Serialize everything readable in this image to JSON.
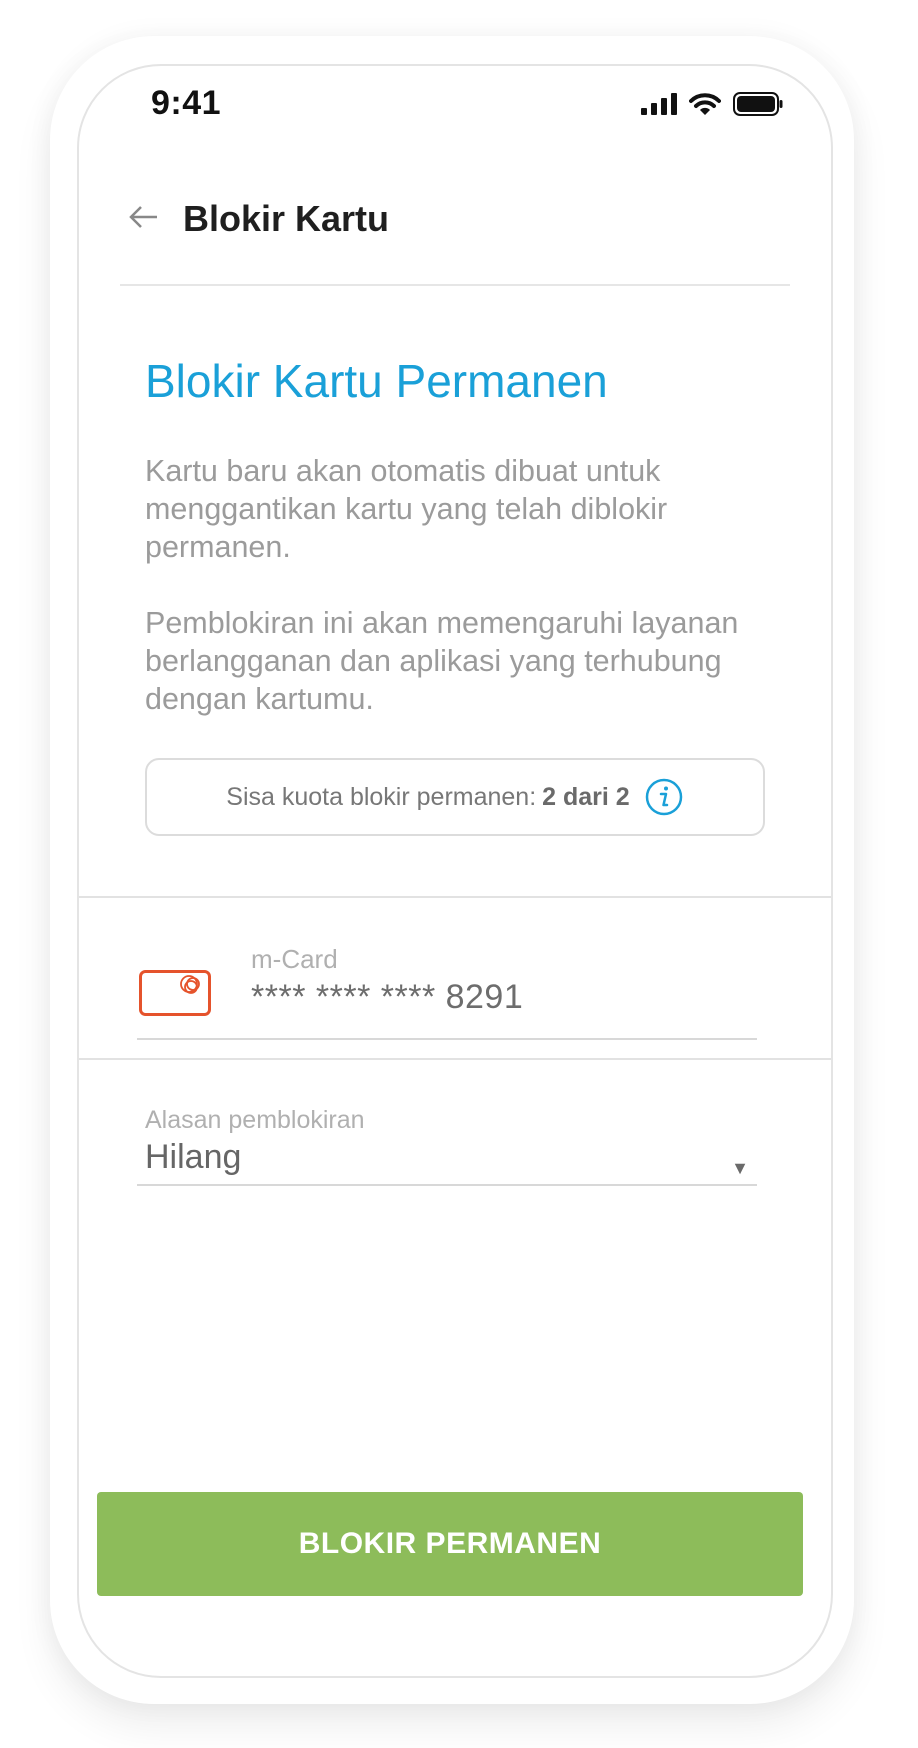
{
  "status_bar": {
    "time": "9:41"
  },
  "header": {
    "title": "Blokir Kartu"
  },
  "content": {
    "heading": "Blokir Kartu Permanen",
    "paragraph_1": "Kartu baru akan otomatis dibuat untuk menggantikan kartu yang telah diblokir permanen.",
    "paragraph_2": "Pemblokiran ini akan memengaruhi layanan berlangganan dan aplikasi yang terhubung dengan kartumu.",
    "quota": {
      "label": "Sisa kuota blokir permanen:",
      "value": "2 dari 2"
    }
  },
  "card": {
    "label": "m-Card",
    "number": "**** **** **** 8291",
    "icon": "card-icon"
  },
  "reason": {
    "label": "Alasan pemblokiran",
    "value": "Hilang",
    "caret": "▼"
  },
  "cta": {
    "label": "BLOKIR PERMANEN"
  },
  "colors": {
    "accent": "#1aa0d8",
    "button": "#8dbc5a",
    "card_outline": "#e5532c"
  }
}
